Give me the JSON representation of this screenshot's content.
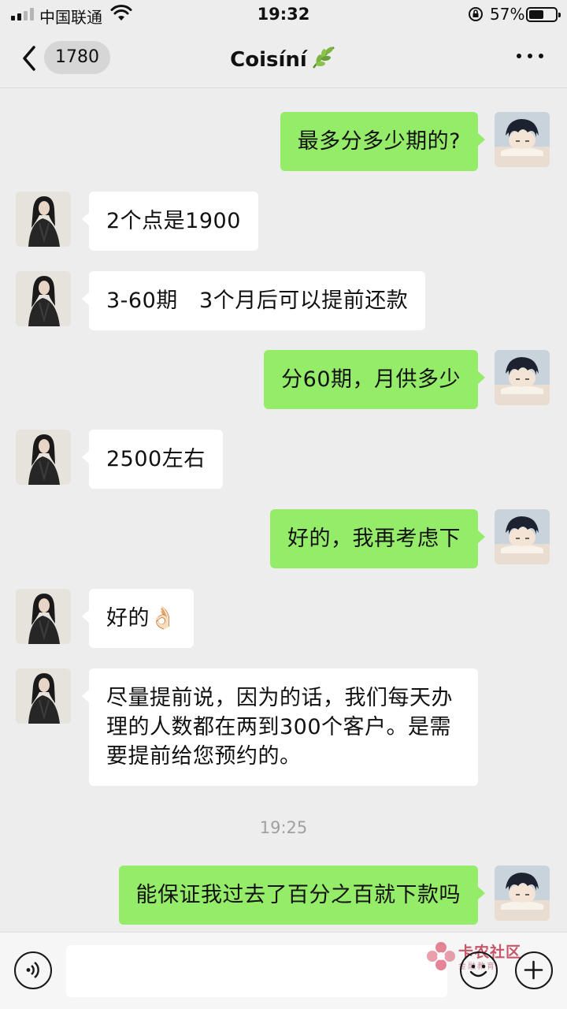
{
  "status_bar": {
    "carrier": "中国联通",
    "time": "19:32",
    "battery_percent": "57%",
    "battery_level": 0.57
  },
  "nav": {
    "back_badge": "1780",
    "title": "Coisíní"
  },
  "messages": [
    {
      "side": "out",
      "text": "最多分多少期的?"
    },
    {
      "side": "in",
      "text": "2个点是1900"
    },
    {
      "side": "in",
      "text": "3-60期   3个月后可以提前还款"
    },
    {
      "side": "out",
      "text": "分60期，月供多少"
    },
    {
      "side": "in",
      "text": "2500左右"
    },
    {
      "side": "out",
      "text": "好的，我再考虑下"
    },
    {
      "side": "in",
      "text": "好的👌🏻"
    },
    {
      "side": "in",
      "text": "尽量提前说，因为的话，我们每天办理的人数都在两到300个客户。是需要提前给您预约的。"
    },
    {
      "side": "out",
      "text": "能保证我过去了百分之百就下款吗"
    }
  ],
  "timestamp": "19:25",
  "watermark": {
    "title": "卡农社区",
    "subtitle": "金融教育"
  },
  "colors": {
    "sent_bubble": "#95ec69",
    "received_bubble": "#ffffff",
    "background": "#ededed"
  }
}
